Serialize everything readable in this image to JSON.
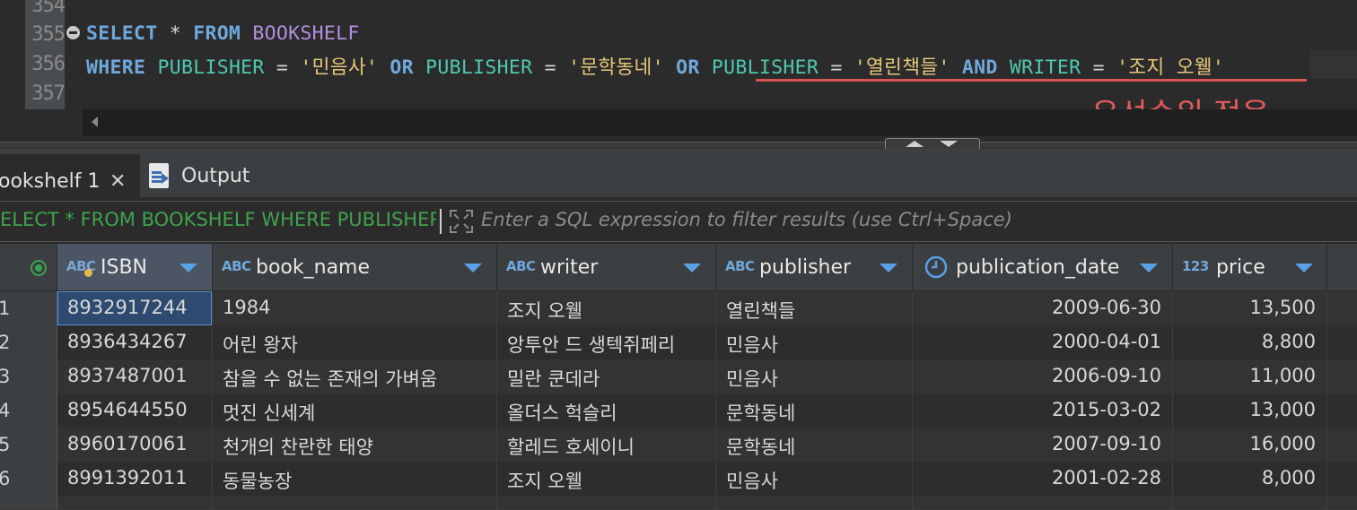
{
  "editor": {
    "line_numbers": [
      "354",
      "355",
      "356",
      "357"
    ],
    "line355": {
      "kw1": "SELECT",
      "star": " * ",
      "kw2": "FROM",
      "table": " BOOKSHELF"
    },
    "line356": {
      "where": "WHERE",
      "col1": " PUBLISHER",
      "eq1": " = ",
      "str1": "'민음사'",
      "or1": " OR",
      "col2": " PUBLISHER",
      "eq2": " = ",
      "str2": "'문학동네'",
      "or2": " OR",
      "col3": " PUBLISHER",
      "eq3": " = ",
      "str3": "'열린책들'",
      "and": " AND",
      "col4": " WRITER",
      "eq4": " = ",
      "str4": "'조지 오웰'"
    },
    "annotation": "우선순위 적용"
  },
  "tabs": {
    "results_label": "ookshelf 1",
    "close_glyph": "✕",
    "output_label": "Output"
  },
  "filter": {
    "query_text": "ELECT * FROM BOOKSHELF WHERE PUBLISHER",
    "placeholder": "Enter a SQL expression to filter results (use Ctrl+Space)"
  },
  "grid": {
    "columns": [
      {
        "type": "ABC",
        "name": "ISBN"
      },
      {
        "type": "ABC",
        "name": "book_name"
      },
      {
        "type": "ABC",
        "name": "writer"
      },
      {
        "type": "ABC",
        "name": "publisher"
      },
      {
        "type": "clock",
        "name": "publication_date"
      },
      {
        "type": "123",
        "name": "price"
      }
    ],
    "rows": [
      {
        "num": "1",
        "isbn": "8932917244",
        "book_name": "1984",
        "writer": "조지 오웰",
        "publisher": "열린책들",
        "date": "2009-06-30",
        "price": "13,500"
      },
      {
        "num": "2",
        "isbn": "8936434267",
        "book_name": "어린 왕자",
        "writer": "앙투안 드 생텍쥐페리",
        "publisher": "민음사",
        "date": "2000-04-01",
        "price": "8,800"
      },
      {
        "num": "3",
        "isbn": "8937487001",
        "book_name": "참을 수 없는 존재의 가벼움",
        "writer": "밀란 쿤데라",
        "publisher": "민음사",
        "date": "2006-09-10",
        "price": "11,000"
      },
      {
        "num": "4",
        "isbn": "8954644550",
        "book_name": "멋진 신세계",
        "writer": "올더스 헉슬리",
        "publisher": "문학동네",
        "date": "2015-03-02",
        "price": "13,000"
      },
      {
        "num": "5",
        "isbn": "8960170061",
        "book_name": "천개의 찬란한 태양",
        "writer": "할레드 호세이니",
        "publisher": "문학동네",
        "date": "2007-09-10",
        "price": "16,000"
      },
      {
        "num": "6",
        "isbn": "8991392011",
        "book_name": "동물농장",
        "writer": "조지 오웰",
        "publisher": "민음사",
        "date": "2001-02-28",
        "price": "8,000"
      }
    ]
  },
  "colors": {
    "keyword": "#6fa8dc",
    "string": "#e6c87a",
    "column": "#4ec9b0",
    "annotation": "#e35b5b",
    "filter_query": "#3fa34d"
  }
}
